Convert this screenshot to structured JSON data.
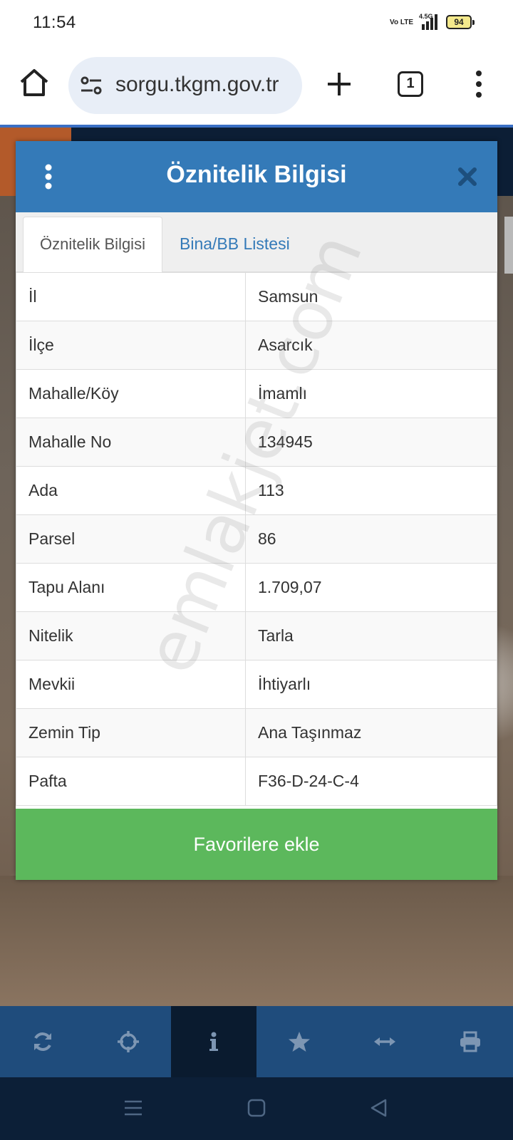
{
  "status_bar": {
    "time": "11:54",
    "volte": "Vo LTE",
    "network": "4.5G",
    "battery": "94"
  },
  "browser": {
    "url": "sorgu.tkgm.gov.tr",
    "tab_count": "1"
  },
  "modal": {
    "title": "Öznitelik Bilgisi",
    "tabs": [
      {
        "label": "Öznitelik Bilgisi",
        "active": true
      },
      {
        "label": "Bina/BB Listesi",
        "active": false
      }
    ],
    "rows": [
      {
        "key": "İl",
        "value": "Samsun"
      },
      {
        "key": "İlçe",
        "value": "Asarcık"
      },
      {
        "key": "Mahalle/Köy",
        "value": "İmamlı"
      },
      {
        "key": "Mahalle No",
        "value": "134945"
      },
      {
        "key": "Ada",
        "value": "113"
      },
      {
        "key": "Parsel",
        "value": "86"
      },
      {
        "key": "Tapu Alanı",
        "value": "1.709,07"
      },
      {
        "key": "Nitelik",
        "value": "Tarla"
      },
      {
        "key": "Mevkii",
        "value": "İhtiyarlı"
      },
      {
        "key": "Zemin Tip",
        "value": "Ana Taşınmaz"
      },
      {
        "key": "Pafta",
        "value": "F36-D-24-C-4"
      }
    ],
    "favorite_button": "Favorilere ekle"
  },
  "watermark": "emlakjet.com",
  "toolbar": {
    "items": [
      "refresh-icon",
      "crosshair-icon",
      "info-icon",
      "star-icon",
      "measure-icon",
      "print-icon"
    ],
    "active_index": 2
  },
  "colors": {
    "header_blue": "#347ab8",
    "favorite_green": "#5cb85c",
    "toolbar_blue": "#1f4c7c",
    "toolbar_active": "#0a1b2f"
  }
}
